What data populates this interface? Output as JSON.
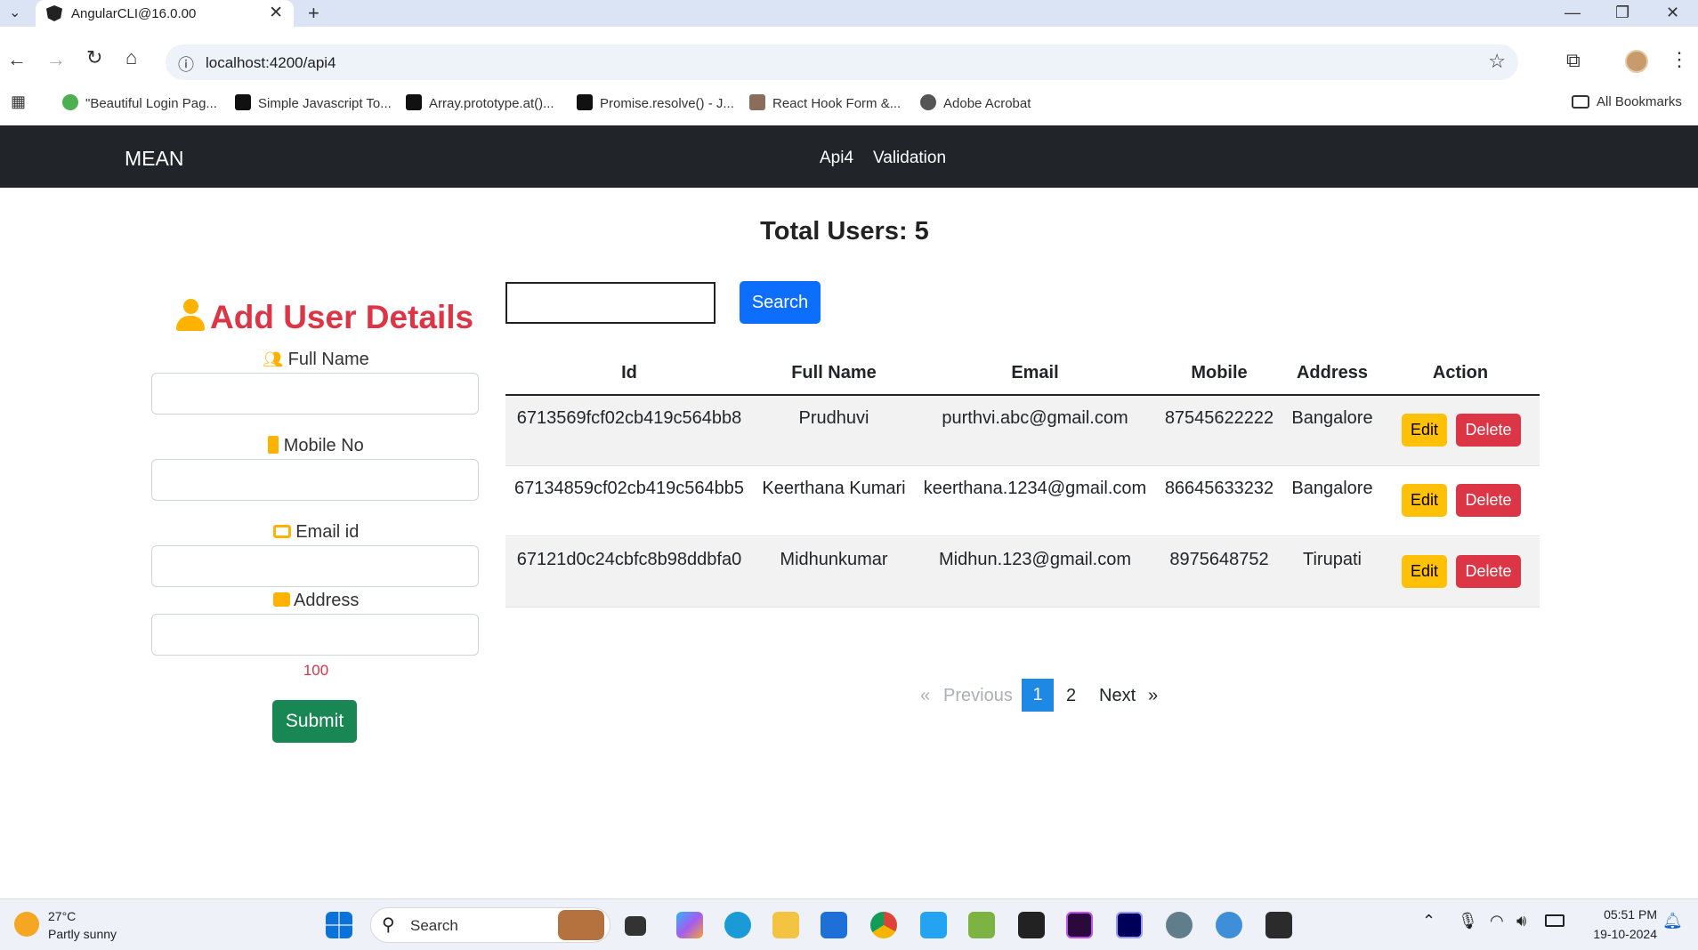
{
  "browser": {
    "tab_title": "AngularCLI@16.0.00",
    "url": "localhost:4200/api4",
    "bookmarks": [
      {
        "label": "\"Beautiful Login Pag...",
        "color": "#4caf50"
      },
      {
        "label": "Simple Javascript To...",
        "color": "#111111"
      },
      {
        "label": "Array.prototype.at()...",
        "color": "#111111"
      },
      {
        "label": "Promise.resolve() - J...",
        "color": "#111111"
      },
      {
        "label": "React Hook Form &...",
        "color": "#8a6d5b"
      },
      {
        "label": "Adobe Acrobat",
        "color": "#555555"
      }
    ],
    "all_bookmarks": "All Bookmarks"
  },
  "app": {
    "brand": "MEAN",
    "nav": [
      "Api4",
      "Validation"
    ],
    "total_users": "Total Users: 5",
    "form": {
      "title": "Add User Details",
      "labels": {
        "full_name": "Full Name",
        "mobile": "Mobile No",
        "email": "Email id",
        "address": "Address"
      },
      "counter": "100",
      "submit": "Submit"
    },
    "search_button": "Search",
    "table": {
      "headers": [
        "Id",
        "Full Name",
        "Email",
        "Mobile",
        "Address",
        "Action"
      ],
      "rows": [
        {
          "id": "6713569fcf02cb419c564bb8",
          "name": "Prudhuvi",
          "email": "purthvi.abc@gmail.com",
          "mobile": "87545622222",
          "address": "Bangalore"
        },
        {
          "id": "67134859cf02cb419c564bb5",
          "name": "Keerthana Kumari",
          "email": "keerthana.1234@gmail.com",
          "mobile": "86645633232",
          "address": "Bangalore"
        },
        {
          "id": "67121d0c24cbfc8b98ddbfa0",
          "name": "Midhunkumar",
          "email": "Midhun.123@gmail.com",
          "mobile": "8975648752",
          "address": "Tirupati"
        }
      ],
      "edit_label": "Edit",
      "delete_label": "Delete"
    },
    "pagination": {
      "prev_arrow": "«",
      "prev": "Previous",
      "pages": [
        "1",
        "2"
      ],
      "next": "Next",
      "next_arrow": "»"
    }
  },
  "taskbar": {
    "weather_temp": "27°C",
    "weather_desc": "Partly sunny",
    "search": "Search",
    "time": "05:51 PM",
    "date": "19-10-2024"
  },
  "colors": {
    "accent": "#0d6efd",
    "danger": "#dc3545",
    "success": "#198754",
    "warning": "#ffc107",
    "nav_bg": "#212529"
  }
}
